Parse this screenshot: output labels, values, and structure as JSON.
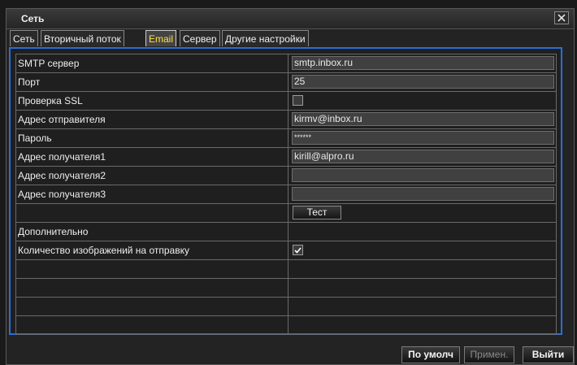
{
  "window": {
    "title": "Сеть"
  },
  "tabs": [
    {
      "label": "Сеть"
    },
    {
      "label": "Вторичный поток"
    },
    {
      "label": "Email"
    },
    {
      "label": "Сервер"
    },
    {
      "label": "Другие настройки"
    }
  ],
  "active_tab": "Email",
  "rows": [
    {
      "label": "SMTP сервер",
      "value": "smtp.inbox.ru"
    },
    {
      "label": "Порт",
      "value": "25"
    },
    {
      "label": "Проверка SSL",
      "checked": false
    },
    {
      "label": "Адрес отправителя",
      "value": "kirmv@inbox.ru"
    },
    {
      "label": "Пароль",
      "value": "******"
    },
    {
      "label": "Адрес получателя1",
      "value": "kirill@alpro.ru"
    },
    {
      "label": "Адрес получателя2",
      "value": ""
    },
    {
      "label": "Адрес получателя3",
      "value": ""
    },
    {
      "label": "",
      "button": "Тест"
    },
    {
      "label": "Дополнительно"
    },
    {
      "label": "Количество изображений на отправку",
      "checked": true
    },
    {
      "label": ""
    },
    {
      "label": ""
    },
    {
      "label": ""
    },
    {
      "label": ""
    }
  ],
  "footer": {
    "default_label": "По умолч",
    "apply_label": "Примен.",
    "exit_label": "Выйти"
  },
  "colors": {
    "accent": "#2d6dd6",
    "active_tab_text": "#ffe23a",
    "background": "#1a1a1a"
  }
}
